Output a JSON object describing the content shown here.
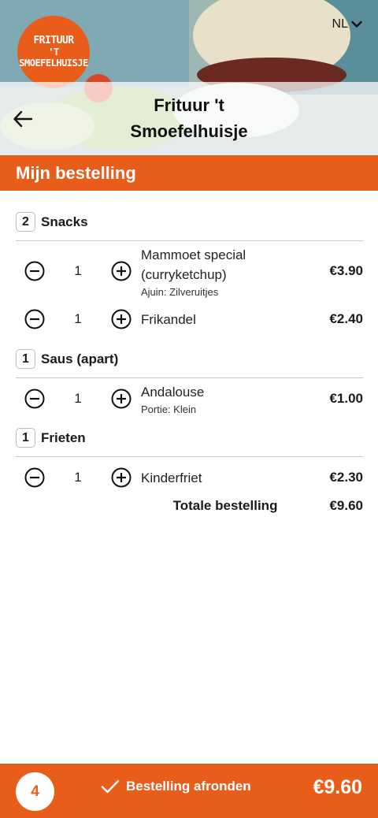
{
  "header": {
    "logo_line1": "FRITUUR",
    "logo_line2": "'T SMOEFELHUISJE",
    "language": "NL",
    "title": "Frituur 't Smoefelhuisje"
  },
  "section_title": "Mijn bestelling",
  "groups": [
    {
      "count": "2",
      "name": "Snacks",
      "items": [
        {
          "qty": "1",
          "name": "Mammoet special (curryketchup)",
          "option": "Ajuin: Zilveruitjes",
          "price": "€3.90"
        },
        {
          "qty": "1",
          "name": "Frikandel",
          "option": "",
          "price": "€2.40"
        }
      ]
    },
    {
      "count": "1",
      "name": "Saus (apart)",
      "items": [
        {
          "qty": "1",
          "name": "Andalouse",
          "option": "Portie: Klein",
          "price": "€1.00"
        }
      ]
    },
    {
      "count": "1",
      "name": "Frieten",
      "items": [
        {
          "qty": "1",
          "name": "Kinderfriet",
          "option": "",
          "price": "€2.30"
        }
      ]
    }
  ],
  "total": {
    "label": "Totale bestelling",
    "value": "€9.60"
  },
  "footer": {
    "item_count": "4",
    "checkout_label": "Bestelling afronden",
    "total": "€9.60"
  },
  "colors": {
    "accent": "#e95d1b"
  }
}
